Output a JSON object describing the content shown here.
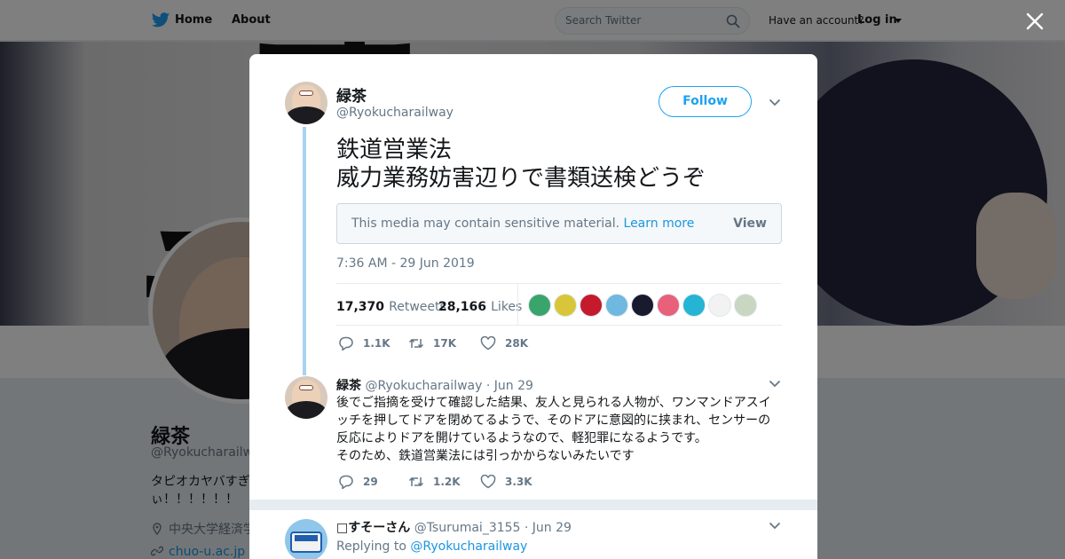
{
  "nav": {
    "home": "Home",
    "about": "About",
    "search_placeholder": "Search Twitter",
    "have_account": "Have an account?",
    "login": "Log in"
  },
  "profile": {
    "name": "緑茶",
    "handle": "@Ryokucharailwa",
    "bio": "タピオカヤバすぎぃ！！！！！！",
    "location": "中央大学経済学",
    "url": "chuo-u.ac.jp"
  },
  "tweet": {
    "author_name": "緑茶",
    "author_handle": "@Ryokucharailway",
    "follow_label": "Follow",
    "text_line1": "鉄道営業法",
    "text_line2": "威力業務妨害辺りで書類送検どうぞ",
    "sensitive_text": "This media may contain sensitive material.",
    "sensitive_link": "Learn more",
    "sensitive_view": "View",
    "timestamp": "7:36 AM - 29 Jun 2019",
    "retweets_count": "17,370",
    "retweets_label": "Retweets",
    "likes_count": "28,166",
    "likes_label": "Likes",
    "actions": {
      "replies": "1.1K",
      "retweets": "17K",
      "likes": "28K"
    },
    "liker_avatar_colors": [
      "#3aa56b",
      "#d9c53a",
      "#c41a2c",
      "#6fb8e0",
      "#1a1a2e",
      "#e8607a",
      "#25b4d4",
      "#f2f2f2",
      "#c9d6c2"
    ]
  },
  "reply1": {
    "name": "緑茶",
    "handle": "@Ryokucharailway",
    "date": "· Jun 29",
    "text_line1": "後でご指摘を受けて確認した結果、友人と見られる人物が、ワンマンドアスイ",
    "text_line2": "ッチを押してドアを閉めてるようで、そのドアに意図的に挟まれ、センサーの",
    "text_line3": "反応によりドアを開けているようなので、軽犯罪になるようです。",
    "text_line4": "そのため、鉄道営業法には引っかからないみたいです",
    "actions": {
      "replies": "29",
      "retweets": "1.2K",
      "likes": "3.3K"
    }
  },
  "reply2": {
    "name": "□すそーさん",
    "handle": "@Tsurumai_3155",
    "date": "· Jun 29",
    "replying_to_label": "Replying to",
    "replying_to_handle": "@Ryokucharailway"
  },
  "colors": {
    "accent": "#1da1f2",
    "thread_line": "#a6d3f2"
  }
}
